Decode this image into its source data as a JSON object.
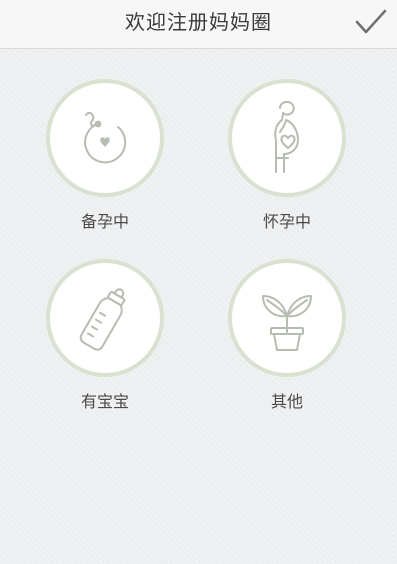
{
  "header": {
    "title": "欢迎注册妈妈圈",
    "confirm_icon": "checkmark-icon"
  },
  "options": [
    {
      "label": "备孕中",
      "icon": "sperm-egg-icon"
    },
    {
      "label": "怀孕中",
      "icon": "pregnant-woman-icon"
    },
    {
      "label": "有宝宝",
      "icon": "baby-bottle-icon"
    },
    {
      "label": "其他",
      "icon": "plant-sprout-icon"
    }
  ],
  "colors": {
    "header_bg": "#f7f7f7",
    "page_bg": "#eceef0",
    "circle_border": "#d9e2d0",
    "icon_stroke": "#b7bcb0",
    "title_text": "#3a3a3a",
    "label_text": "#4a4a4a"
  }
}
